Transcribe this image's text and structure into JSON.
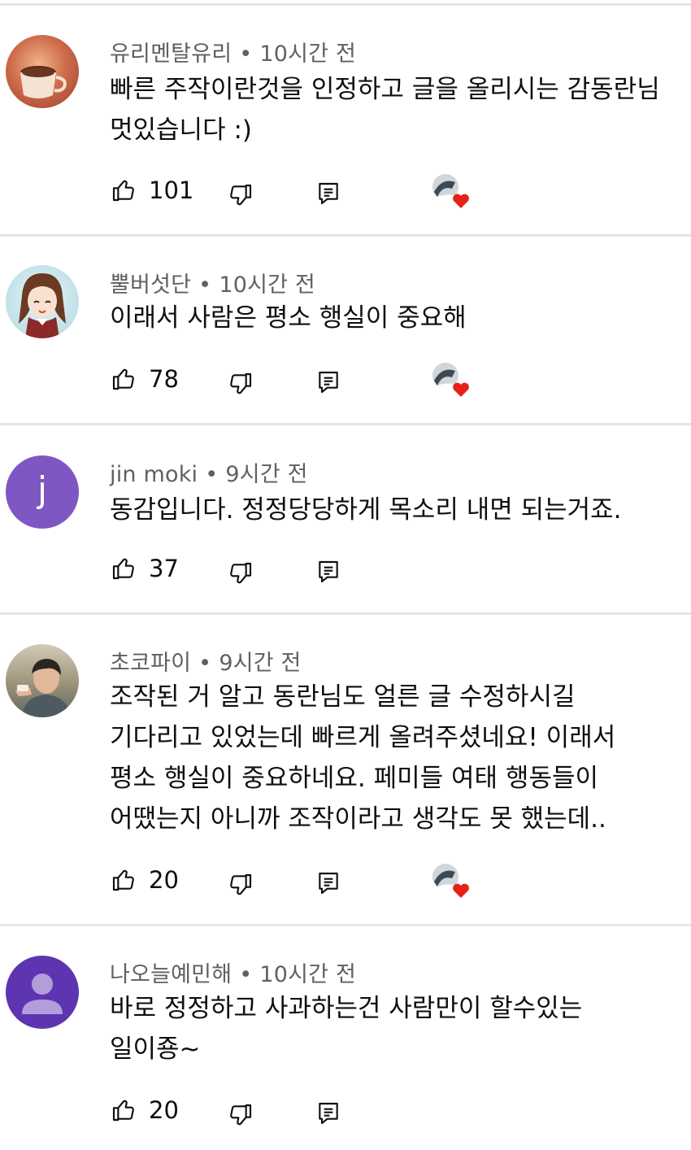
{
  "comments": [
    {
      "author": "유리멘탈유리",
      "separator": "•",
      "time": "10시간 전",
      "lines": [
        "빠른 주작이란것을 인정하고 글을 올리시는 감동란님",
        "멋있습니다 :)"
      ],
      "likes": "101",
      "creator_heart": true,
      "avatar": {
        "type": "photo-cup",
        "color": "#b4553b"
      }
    },
    {
      "author": "뿔버섯단",
      "separator": "•",
      "time": "10시간 전",
      "lines": [
        "이래서 사람은 평소 행실이 중요해"
      ],
      "likes": "78",
      "creator_heart": true,
      "avatar": {
        "type": "anime-character",
        "color": "#6b3a22"
      }
    },
    {
      "author": "jin moki",
      "separator": "•",
      "time": "9시간 전",
      "lines": [
        "동감입니다. 정정당당하게 목소리 내면 되는거죠."
      ],
      "likes": "37",
      "creator_heart": false,
      "avatar": {
        "type": "letter",
        "letter": "j",
        "color": "#7e57c2"
      }
    },
    {
      "author": "초코파이",
      "separator": "•",
      "time": "9시간 전",
      "lines": [
        "조작된 거 알고 동란님도 얼른 글 수정하시길",
        "기다리고 있었는데 빠르게 올려주셨네요! 이래서",
        "평소 행실이 중요하네요. 페미들 여태 행동들이",
        "어땠는지 아니까 조작이라고 생각도 못 했는데.."
      ],
      "likes": "20",
      "creator_heart": true,
      "avatar": {
        "type": "photo-person",
        "color": "#8a7f6a"
      }
    },
    {
      "author": "나오늘예민해",
      "separator": "•",
      "time": "10시간 전",
      "lines": [
        "바로 정정하고 사과하는건 사람만이 할수있는",
        "일이죵~"
      ],
      "likes": "20",
      "creator_heart": false,
      "avatar": {
        "type": "default-person",
        "color": "#5e35b1"
      }
    }
  ],
  "icons": {
    "like": "thumb-up-icon",
    "dislike": "thumb-down-icon",
    "reply": "reply-icon",
    "heart": "creator-heart-icon"
  },
  "colors": {
    "text": "#0f0f0f",
    "meta": "#606060",
    "divider": "#e5e5e5",
    "heart": "#e62117"
  }
}
